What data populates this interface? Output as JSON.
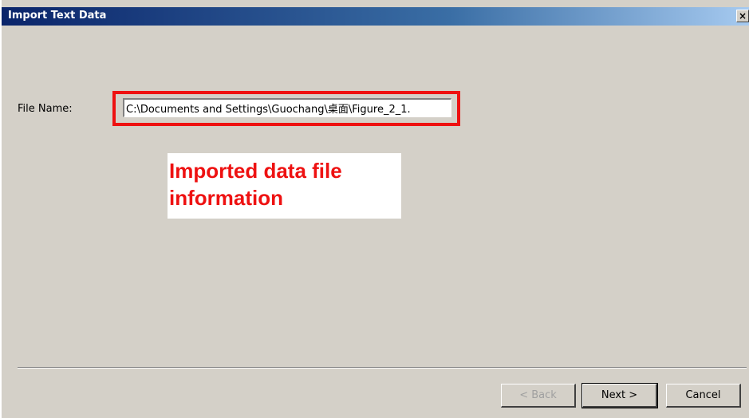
{
  "window": {
    "title": "Import Text Data",
    "close_glyph": "×"
  },
  "form": {
    "file_name_label": "File Name:",
    "file_name_value": "C:\\Documents and Settings\\Guochang\\桌面\\Figure_2_1."
  },
  "annotation": {
    "text_line1": "Imported data file",
    "text_line2": "information",
    "color": "#ee1111"
  },
  "buttons": {
    "back_label": "< Back",
    "next_label": "Next >",
    "cancel_label": "Cancel"
  },
  "colors": {
    "dialog_bg": "#d4d0c8",
    "titlebar_start": "#0a246a",
    "titlebar_end": "#a6caf0"
  },
  "icons": {
    "close": "close-icon"
  }
}
